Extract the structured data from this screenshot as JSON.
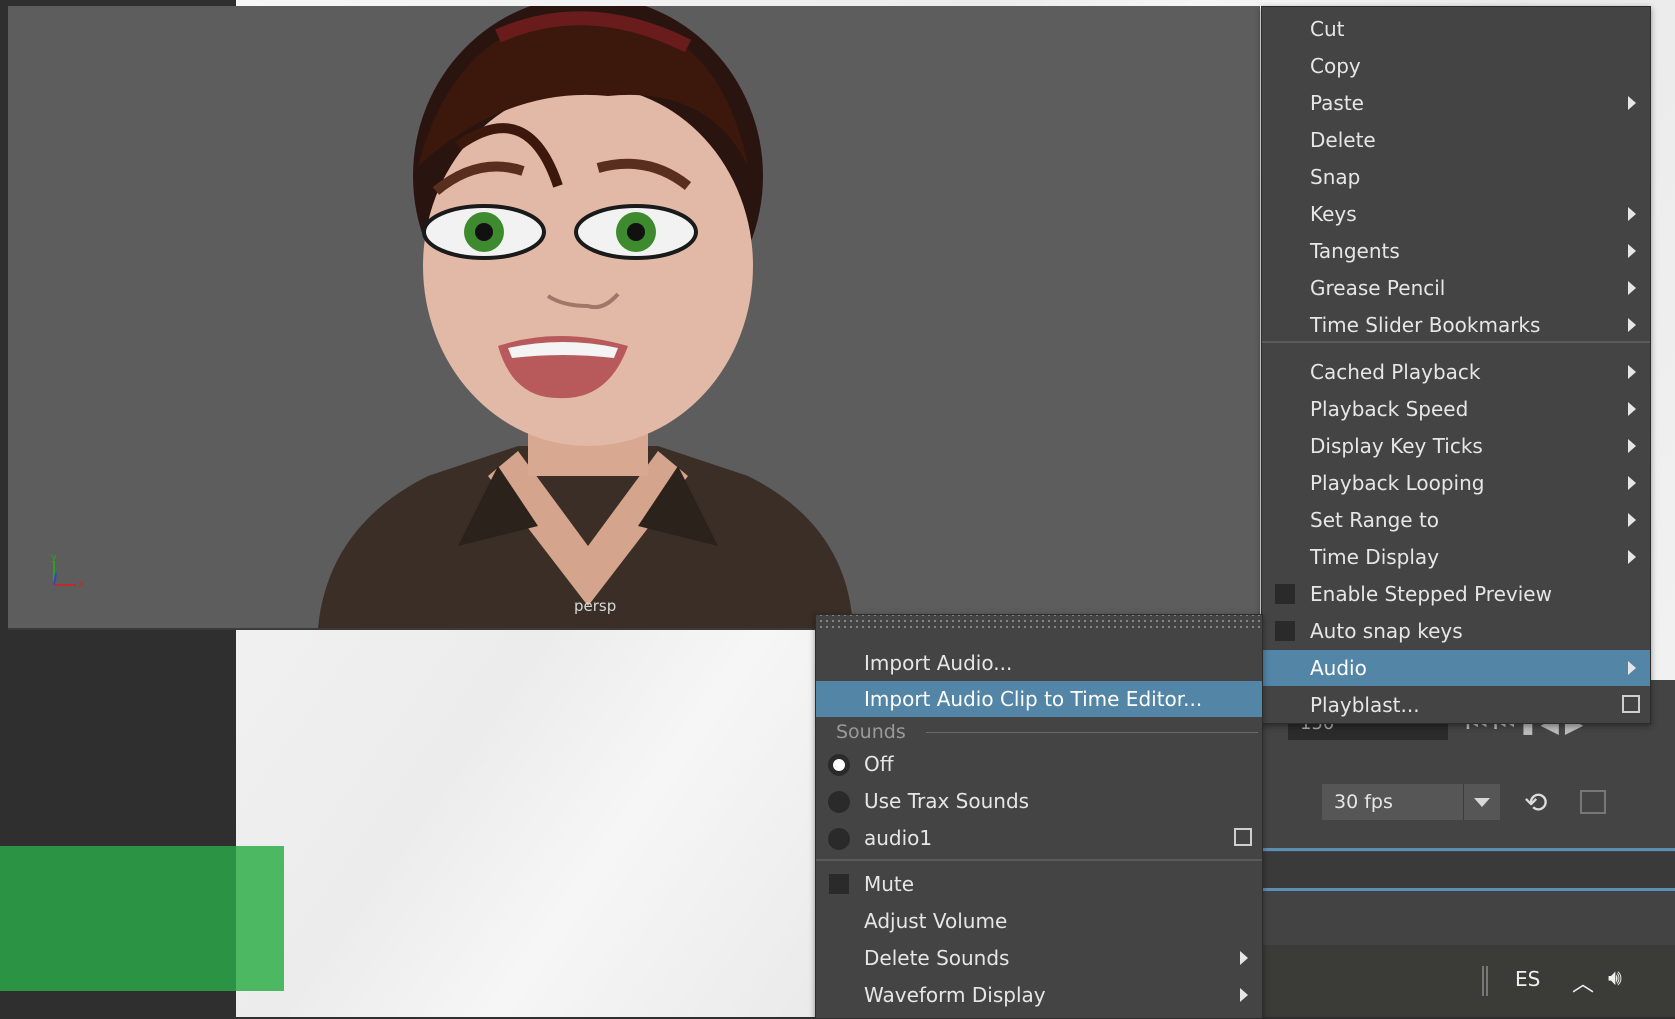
{
  "viewport": {
    "camera_label": "persp",
    "axis": {
      "y": "y",
      "x": "x"
    }
  },
  "main_menu": {
    "items": [
      {
        "label": "Cut",
        "submenu": false
      },
      {
        "label": "Copy",
        "submenu": false
      },
      {
        "label": "Paste",
        "submenu": true
      },
      {
        "label": "Delete",
        "submenu": false
      },
      {
        "label": "Snap",
        "submenu": false
      },
      {
        "label": "Keys",
        "submenu": true
      },
      {
        "label": "Tangents",
        "submenu": true
      },
      {
        "label": "Grease Pencil",
        "submenu": true
      },
      {
        "label": "Time Slider Bookmarks",
        "submenu": true
      },
      {
        "label": "Cached Playback",
        "submenu": true
      },
      {
        "label": "Playback Speed",
        "submenu": true
      },
      {
        "label": "Display Key Ticks",
        "submenu": true
      },
      {
        "label": "Playback Looping",
        "submenu": true
      },
      {
        "label": "Set Range to",
        "submenu": true
      },
      {
        "label": "Time Display",
        "submenu": true
      },
      {
        "label": "Enable Stepped Preview",
        "checkbox": true,
        "checked": false
      },
      {
        "label": "Auto snap keys",
        "checkbox": true,
        "checked": false
      },
      {
        "label": "Audio",
        "submenu": true,
        "highlighted": true
      },
      {
        "label": "Playblast...",
        "option_box": true
      }
    ]
  },
  "audio_submenu": {
    "import_audio": "Import Audio...",
    "import_clip": "Import Audio Clip to Time Editor...",
    "sounds_section": "Sounds",
    "sounds": [
      {
        "label": "Off",
        "selected": true
      },
      {
        "label": "Use Trax Sounds",
        "selected": false
      },
      {
        "label": "audio1",
        "selected": false,
        "option_box": true
      }
    ],
    "mute": "Mute",
    "adjust_volume": "Adjust Volume",
    "delete_sounds": "Delete Sounds",
    "waveform_display": "Waveform Display"
  },
  "timeline": {
    "end_field": "150",
    "fps": "30 fps"
  },
  "taskbar": {
    "language": "ES"
  },
  "colors": {
    "highlight": "#5285a6",
    "menu_bg": "#444444",
    "slide_green": "#2b9444"
  }
}
